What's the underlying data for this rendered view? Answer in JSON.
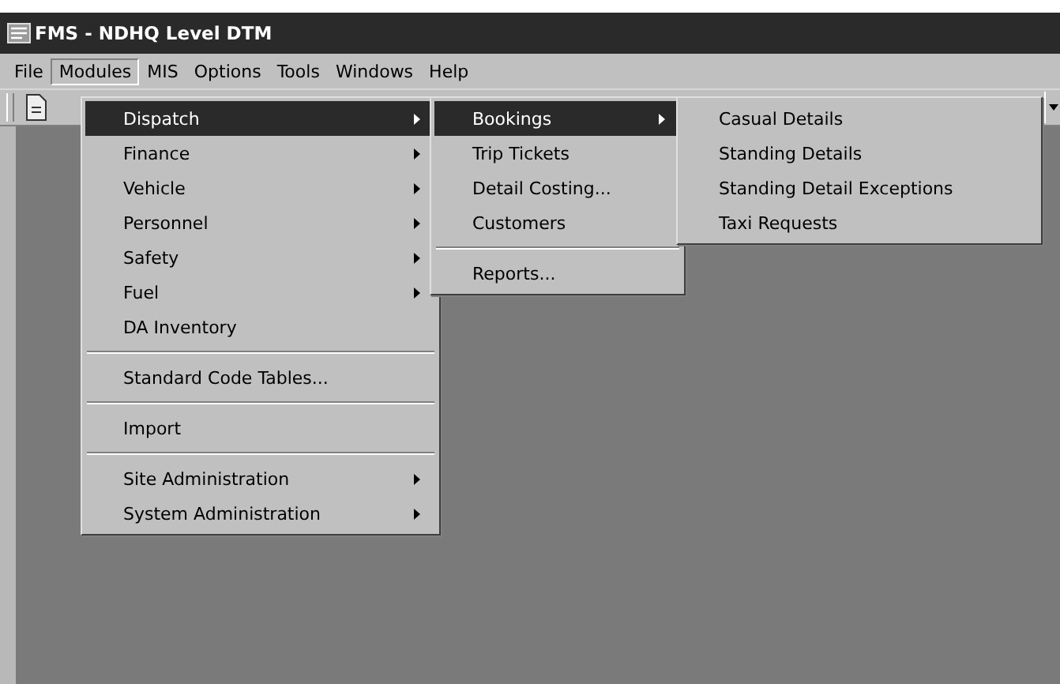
{
  "window": {
    "title": "FMS - NDHQ Level DTM"
  },
  "menubar": [
    {
      "label": "File",
      "selected": false
    },
    {
      "label": "Modules",
      "selected": true
    },
    {
      "label": "MIS",
      "selected": false
    },
    {
      "label": "Options",
      "selected": false
    },
    {
      "label": "Tools",
      "selected": false
    },
    {
      "label": "Windows",
      "selected": false
    },
    {
      "label": "Help",
      "selected": false
    }
  ],
  "modules_menu": [
    {
      "kind": "item",
      "label": "Dispatch",
      "submenu": true,
      "selected": true
    },
    {
      "kind": "item",
      "label": "Finance",
      "submenu": true,
      "selected": false
    },
    {
      "kind": "item",
      "label": "Vehicle",
      "submenu": true,
      "selected": false
    },
    {
      "kind": "item",
      "label": "Personnel",
      "submenu": true,
      "selected": false
    },
    {
      "kind": "item",
      "label": "Safety",
      "submenu": true,
      "selected": false
    },
    {
      "kind": "item",
      "label": "Fuel",
      "submenu": true,
      "selected": false
    },
    {
      "kind": "item",
      "label": "DA Inventory",
      "submenu": false,
      "selected": false
    },
    {
      "kind": "separator"
    },
    {
      "kind": "item",
      "label": "Standard Code Tables...",
      "submenu": false,
      "selected": false
    },
    {
      "kind": "separator"
    },
    {
      "kind": "item",
      "label": "Import",
      "submenu": false,
      "selected": false
    },
    {
      "kind": "separator"
    },
    {
      "kind": "item",
      "label": "Site Administration",
      "submenu": true,
      "selected": false
    },
    {
      "kind": "item",
      "label": "System Administration",
      "submenu": true,
      "selected": false
    }
  ],
  "dispatch_menu": [
    {
      "kind": "item",
      "label": "Bookings",
      "submenu": true,
      "selected": true
    },
    {
      "kind": "item",
      "label": "Trip Tickets",
      "submenu": false,
      "selected": false
    },
    {
      "kind": "item",
      "label": "Detail Costing...",
      "submenu": false,
      "selected": false
    },
    {
      "kind": "item",
      "label": "Customers",
      "submenu": false,
      "selected": false
    },
    {
      "kind": "separator"
    },
    {
      "kind": "item",
      "label": "Reports...",
      "submenu": false,
      "selected": false
    }
  ],
  "bookings_menu": [
    {
      "kind": "item",
      "label": "Casual Details",
      "submenu": false,
      "selected": false
    },
    {
      "kind": "item",
      "label": "Standing Details",
      "submenu": false,
      "selected": false
    },
    {
      "kind": "item",
      "label": "Standing Detail Exceptions",
      "submenu": false,
      "selected": false
    },
    {
      "kind": "item",
      "label": "Taxi Requests",
      "submenu": false,
      "selected": false
    }
  ]
}
